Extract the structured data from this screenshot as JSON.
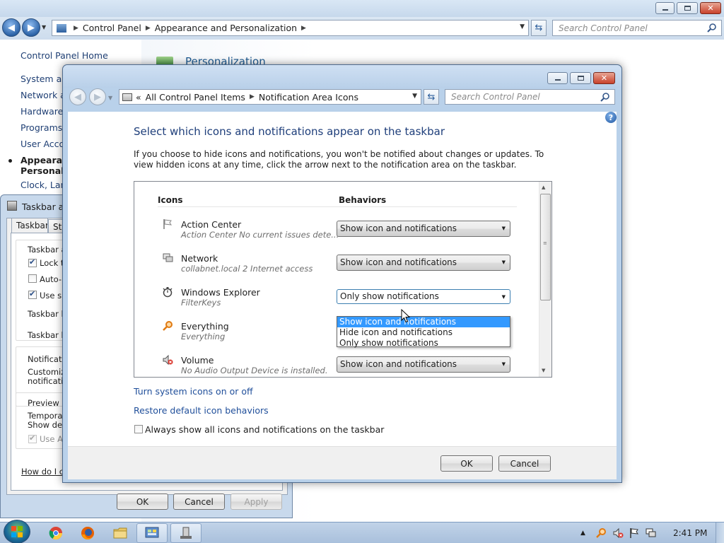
{
  "bg_window": {
    "breadcrumb": [
      "Control Panel",
      "Appearance and Personalization"
    ],
    "search_placeholder": "Search Control Panel",
    "nav": {
      "home": "Control Panel Home",
      "items": [
        "System and",
        "Network an",
        "Hardware a",
        "Programs",
        "User Accou"
      ],
      "current_line1": "Appearanc",
      "current_line2": "Personaliz",
      "clock": "Clock, Lang"
    },
    "header": "Personalization"
  },
  "taskbar_dialog": {
    "title": "Taskbar an",
    "tabs": [
      "Taskbar",
      "Sta"
    ],
    "group1_label": "Taskbar ap",
    "lock": "Lock th",
    "autohide": "Auto-hi",
    "small": "Use sm",
    "location": "Taskbar lo",
    "buttons": "Taskbar bu",
    "notif_label": "Notification",
    "notif_line1": "Customize",
    "notif_line2": "notificatio",
    "preview_label": "Preview de",
    "preview_line1": "Temporaril",
    "preview_line2": "Show desk",
    "aero": "Use Ae",
    "help_link": "How do I cus",
    "ok": "OK",
    "cancel": "Cancel",
    "apply": "Apply"
  },
  "nai_window": {
    "breadcrumb": [
      "All Control Panel Items",
      "Notification Area Icons"
    ],
    "breadcrumb_prefix": "«",
    "search_placeholder": "Search Control Panel",
    "heading": "Select which icons and notifications appear on the taskbar",
    "description": "If you choose to hide icons and notifications, you won't be notified about changes or updates. To view hidden icons at any time, click the arrow next to the notification area on the taskbar.",
    "col_icons": "Icons",
    "col_behaviors": "Behaviors",
    "rows": [
      {
        "name": "Action Center",
        "sub": "Action Center  No current issues dete...",
        "behavior": "Show icon and notifications",
        "icon": "flag-icon"
      },
      {
        "name": "Network",
        "sub": "collabnet.local  2 Internet access",
        "behavior": "Show icon and notifications",
        "icon": "network-icon"
      },
      {
        "name": "Windows Explorer",
        "sub": "FilterKeys",
        "behavior": "Only show notifications",
        "icon": "stopwatch-icon"
      },
      {
        "name": "Everything",
        "sub": "Everything",
        "behavior": "",
        "icon": "magnifier-icon"
      },
      {
        "name": "Volume",
        "sub": "No Audio Output Device is installed.",
        "behavior": "Show icon and notifications",
        "icon": "speaker-muted-icon"
      }
    ],
    "dropdown_options": [
      "Show icon and notifications",
      "Hide icon and notifications",
      "Only show notifications"
    ],
    "dropdown_highlighted": "Show icon and notifications",
    "link_system_icons": "Turn system icons on or off",
    "link_restore": "Restore default icon behaviors",
    "always_show_label": "Always show all icons and notifications on the taskbar",
    "always_show_checked": false,
    "ok": "OK",
    "cancel": "Cancel"
  },
  "taskbar": {
    "clock": "2:41 PM",
    "pinned": [
      "chrome-icon",
      "firefox-icon",
      "folder-icon",
      "control-panel-icon",
      "taskbar-properties-icon"
    ],
    "tray": [
      "show-hidden-icons-arrow",
      "everything-icon",
      "volume-muted-icon",
      "action-center-flag-icon",
      "network-icon"
    ]
  },
  "colors": {
    "accent_blue": "#1e3e7a",
    "link_blue": "#1f4e9a",
    "selection": "#3399ff"
  }
}
